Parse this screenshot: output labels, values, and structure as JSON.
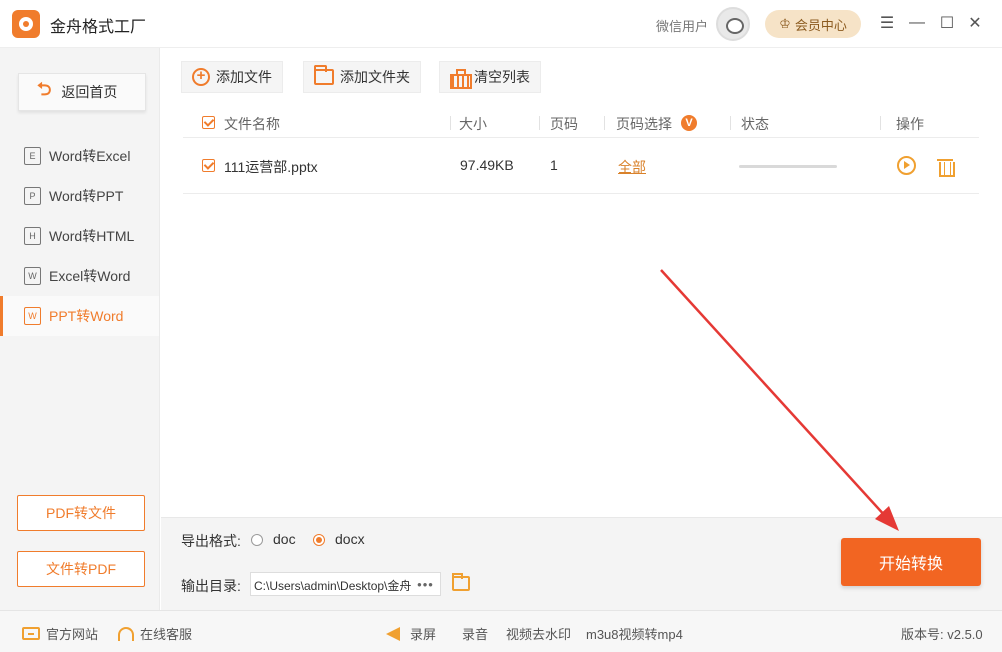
{
  "app": {
    "title": "金舟格式工厂"
  },
  "header": {
    "user_name": "微信用户",
    "vip_label": "会员中心",
    "window_controls": [
      "menu-icon",
      "minimize-icon",
      "maximize-icon",
      "close-icon"
    ]
  },
  "sidebar": {
    "home_label": "返回首页",
    "items": [
      {
        "label": "Word转Excel",
        "icon_letter": "E",
        "active": false
      },
      {
        "label": "Word转PPT",
        "icon_letter": "P",
        "active": false
      },
      {
        "label": "Word转HTML",
        "icon_letter": "H",
        "active": false
      },
      {
        "label": "Excel转Word",
        "icon_letter": "W",
        "active": false
      },
      {
        "label": "PPT转Word",
        "icon_letter": "W",
        "active": true
      }
    ],
    "pdf_to_file": "PDF转文件",
    "file_to_pdf": "文件转PDF"
  },
  "toolbar": {
    "add_file": "添加文件",
    "add_folder": "添加文件夹",
    "clear_list": "清空列表"
  },
  "table": {
    "columns": {
      "name": "文件名称",
      "size": "大小",
      "pages": "页码",
      "page_select": "页码选择",
      "page_select_badge": "V",
      "status": "状态",
      "actions": "操作"
    },
    "rows": [
      {
        "name": "111运营部.pptx",
        "size": "97.49KB",
        "pages": "1",
        "page_select": "全部",
        "progress": 0
      }
    ]
  },
  "output": {
    "format_label": "导出格式:",
    "formats": [
      {
        "label": "doc",
        "selected": false
      },
      {
        "label": "docx",
        "selected": true
      }
    ],
    "dir_label": "输出目录:",
    "dir_value": "C:\\Users\\admin\\Desktop\\金舟",
    "dir_more": "•••"
  },
  "start_button": "开始转换",
  "statusbar": {
    "website": "官方网站",
    "support": "在线客服",
    "record_screen": "录屏",
    "record_audio": "录音",
    "video_watermark": "视频去水印",
    "m3u8": "m3u8视频转mp4",
    "version": "版本号: v2.5.0"
  },
  "colors": {
    "accent": "#f07c2c",
    "start_button": "#f26522",
    "annotation_arrow": "#e53935"
  }
}
